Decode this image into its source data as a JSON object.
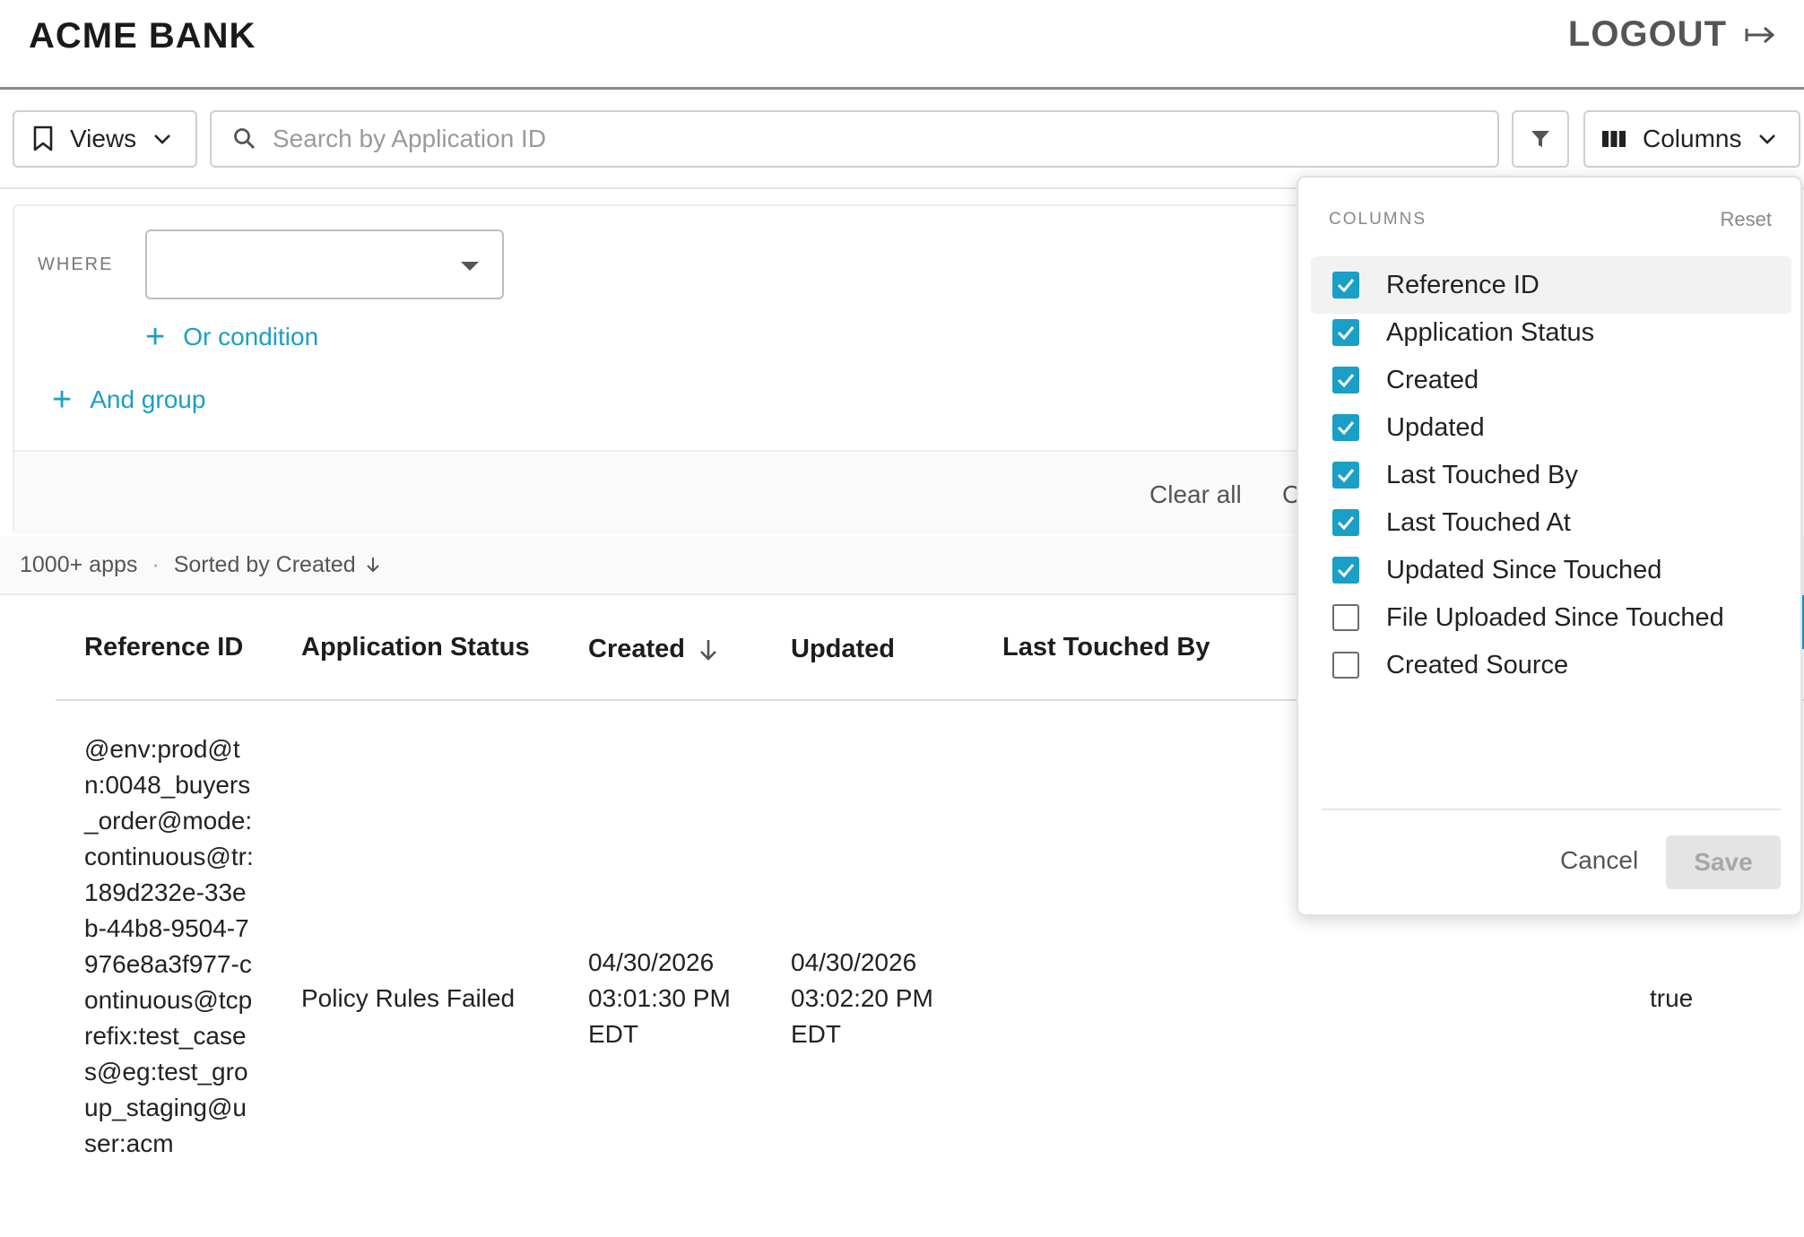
{
  "header": {
    "brand": "ACME BANK",
    "logout_label": "LOGOUT"
  },
  "toolbar": {
    "views_label": "Views",
    "search_placeholder": "Search by Application ID",
    "columns_label": "Columns"
  },
  "filter": {
    "where_label": "WHERE",
    "or_condition": "Or condition",
    "and_group": "And group",
    "clear_all": "Clear all",
    "apply_partial": "C"
  },
  "meta": {
    "count": "1000+ apps",
    "separator": "·",
    "sorted_by": "Sorted by Created"
  },
  "table": {
    "headers": [
      "Reference ID",
      "Application Status",
      "Created",
      "Updated",
      "Last Touched By"
    ],
    "rows": [
      {
        "reference_id": "@env:prod@tn:0048_buyers_order@mode:continuous@tr:189d232e-33eb-44b8-9504-7976e8a3f977-continuous@tcprefix:test_cases@eg:test_group_staging@user:acm",
        "status": "Policy Rules Failed",
        "created": "04/30/2026 03:01:30 PM EDT",
        "updated": "04/30/2026 03:02:20 PM EDT",
        "updated_since_touched": "true"
      }
    ]
  },
  "columns_popover": {
    "title": "COLUMNS",
    "reset": "Reset",
    "options": [
      {
        "label": "Reference ID",
        "checked": true
      },
      {
        "label": "Application Status",
        "checked": true
      },
      {
        "label": "Created",
        "checked": true
      },
      {
        "label": "Updated",
        "checked": true
      },
      {
        "label": "Last Touched By",
        "checked": true
      },
      {
        "label": "Last Touched At",
        "checked": true
      },
      {
        "label": "Updated Since Touched",
        "checked": true
      },
      {
        "label": "File Uploaded Since Touched",
        "checked": false
      },
      {
        "label": "Created Source",
        "checked": false
      }
    ],
    "cancel": "Cancel",
    "save": "Save"
  },
  "colors": {
    "accent": "#1a9fc7",
    "header_rule": "#8a8a8a",
    "save_disabled_bg": "#e4e4e4"
  }
}
